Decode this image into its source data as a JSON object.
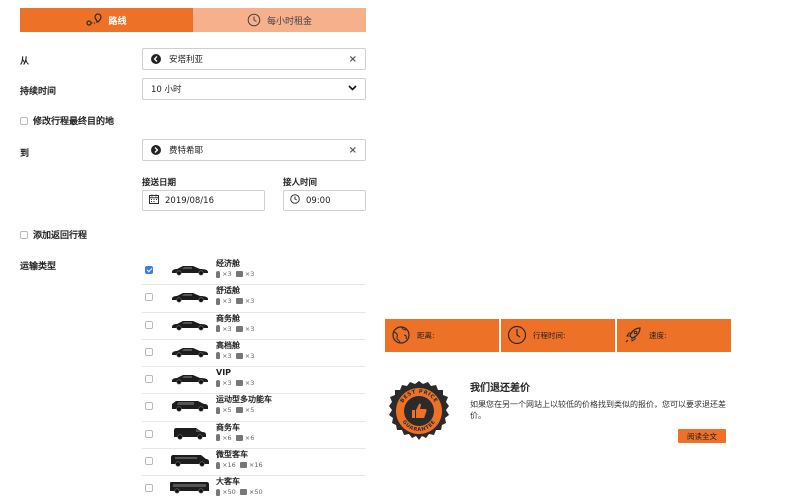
{
  "tabs": [
    {
      "label": "路线",
      "active": true,
      "icon": "route-icon"
    },
    {
      "label": "每小时租金",
      "active": false,
      "icon": "clock-icon"
    }
  ],
  "form": {
    "from_label": "从",
    "from_value": "安塔利亚",
    "duration_label": "持续时间",
    "duration_value": "10 小时",
    "modify_dest_label": "修改行程最终目的地",
    "to_label": "到",
    "to_value": "费特希耶",
    "date_label": "接送日期",
    "date_value": "2019/08/16",
    "time_label": "接人时间",
    "time_value": "09:00",
    "return_label": "添加返回行程",
    "transport_label": "运输类型"
  },
  "vehicles": [
    {
      "name": "经济舱",
      "passengers": "×3",
      "bags": "×3",
      "checked": true,
      "car": "sedan"
    },
    {
      "name": "舒适舱",
      "passengers": "×3",
      "bags": "×3",
      "checked": false,
      "car": "sedan"
    },
    {
      "name": "商务舱",
      "passengers": "×3",
      "bags": "×3",
      "checked": false,
      "car": "sedan"
    },
    {
      "name": "高档舱",
      "passengers": "×3",
      "bags": "×3",
      "checked": false,
      "car": "sedan"
    },
    {
      "name": "VIP",
      "passengers": "×3",
      "bags": "×3",
      "checked": false,
      "car": "sedan"
    },
    {
      "name": "运动型多功能车",
      "passengers": "×5",
      "bags": "×5",
      "checked": false,
      "car": "suv"
    },
    {
      "name": "商务车",
      "passengers": "×6",
      "bags": "×6",
      "checked": false,
      "car": "van"
    },
    {
      "name": "微型客车",
      "passengers": "×16",
      "bags": "×16",
      "checked": false,
      "car": "minibus"
    },
    {
      "name": "大客车",
      "passengers": "×50",
      "bags": "×50",
      "checked": false,
      "car": "bus"
    }
  ],
  "infobar": {
    "distance_label": "距离:",
    "duration_label": "行程时间:",
    "speed_label": "速度:"
  },
  "guarantee": {
    "badge_top": "BEST PRICE",
    "badge_bottom": "GUARANTEE",
    "title": "我们退还差价",
    "text": "如果您在另一个网站上以较低的价格找到类似的报价，您可以要求退还差价。",
    "button": "阅读全文"
  },
  "colors": {
    "accent": "#ee7128",
    "accent_light": "#f6b08c",
    "badge_dark": "#2b2b2b"
  }
}
